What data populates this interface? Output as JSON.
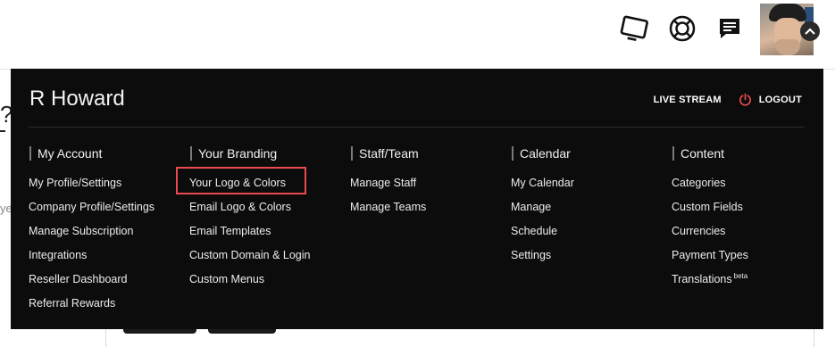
{
  "header": {
    "icons": [
      "tv-icon",
      "lifebuoy-icon",
      "chat-icon"
    ],
    "avatar_alt": "user avatar"
  },
  "background": {
    "frag1": "?",
    "frag3": "ye"
  },
  "menu": {
    "user_name": "R Howard",
    "live_stream": "LIVE STREAM",
    "logout": "LOGOUT",
    "accent_color": "#e84a4f",
    "columns": [
      {
        "title": "My Account",
        "items": [
          "My Profile/Settings",
          "Company Profile/Settings",
          "Manage Subscription",
          "Integrations",
          "Reseller Dashboard",
          "Referral Rewards"
        ]
      },
      {
        "title": "Your Branding",
        "items": [
          "Your Logo & Colors",
          "Email Logo & Colors",
          "Email Templates",
          "Custom Domain & Login",
          "Custom Menus"
        ]
      },
      {
        "title": "Staff/Team",
        "items": [
          "Manage Staff",
          "Manage Teams"
        ]
      },
      {
        "title": "Calendar",
        "items": [
          "My Calendar",
          "Manage",
          "Schedule",
          "Settings"
        ]
      },
      {
        "title": "Content",
        "items": [
          "Categories",
          "Custom Fields",
          "Currencies",
          "Payment Types",
          "Translations"
        ]
      }
    ],
    "translations_badge": "beta",
    "highlighted_item": "Your Logo & Colors"
  }
}
